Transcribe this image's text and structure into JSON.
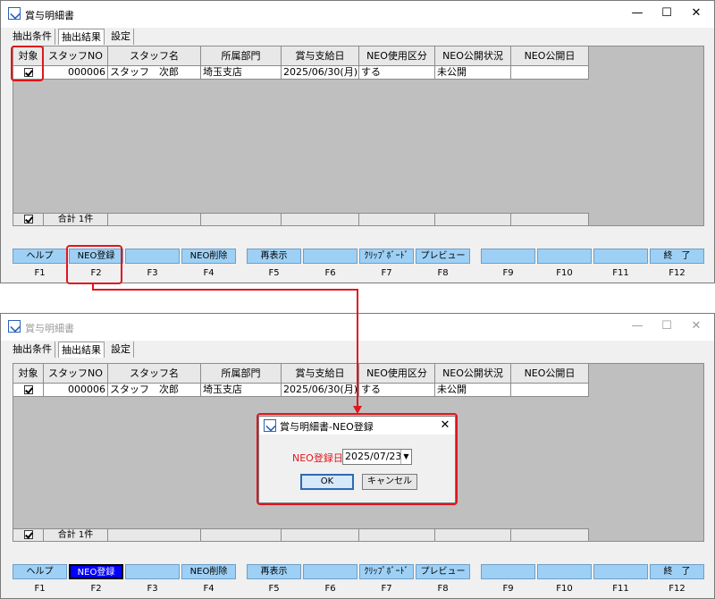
{
  "window_title": "賞与明細書",
  "tabs": [
    "抽出条件",
    "抽出結果",
    "設定"
  ],
  "columns": [
    "対象",
    "スタッフNO",
    "スタッフ名",
    "所属部門",
    "賞与支給日",
    "NEO使用区分",
    "NEO公開状況",
    "NEO公開日"
  ],
  "row": {
    "staff_no": "000006",
    "staff_name": "スタッフ　次郎",
    "department": "埼玉支店",
    "pay_date": "2025/06/30(月)",
    "neo_usage": "する",
    "neo_status": "未公開",
    "neo_date": ""
  },
  "total": "合計 1件",
  "fkeys": [
    {
      "key": "F1",
      "label": "ヘルプ"
    },
    {
      "key": "F2",
      "label": "NEO登録"
    },
    {
      "key": "F3",
      "label": ""
    },
    {
      "key": "F4",
      "label": "NEO削除"
    },
    {
      "key": "F5",
      "label": "再表示"
    },
    {
      "key": "F6",
      "label": ""
    },
    {
      "key": "F7",
      "label": "ｸﾘｯﾌﾟﾎﾞｰﾄﾞ"
    },
    {
      "key": "F8",
      "label": "プレビュー"
    },
    {
      "key": "F9",
      "label": ""
    },
    {
      "key": "F10",
      "label": ""
    },
    {
      "key": "F11",
      "label": ""
    },
    {
      "key": "F12",
      "label": "終　了"
    }
  ],
  "dialog": {
    "title": "賞与明細書-NEO登録",
    "date_label": "NEO登録日",
    "date_value": "2025/07/23",
    "ok": "OK",
    "cancel": "キャンセル",
    "close": "✕"
  },
  "colors": {
    "highlight": "#e0161c",
    "fkey": "#9ed0f5",
    "pressed": "#0000ff",
    "grid_bg": "#bfbfbf"
  }
}
